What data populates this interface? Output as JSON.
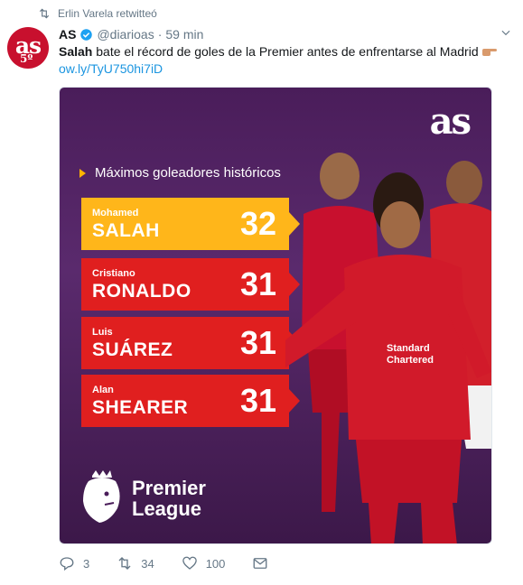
{
  "retweet": {
    "label": "Erlin Varela retwitteó"
  },
  "author": {
    "name": "AS",
    "handle": "@diarioas",
    "time": "59 min"
  },
  "tweet": {
    "bold_word": "Salah",
    "text": " bate el récord de goles de la Premier antes de enfrentarse al Madrid",
    "link": "ow.ly/TyU750hi7iD"
  },
  "media": {
    "brand": "as",
    "heading": "Máximos goleadores históricos",
    "ranking": [
      {
        "first_name": "Mohamed",
        "last_name": "SALAH",
        "goals": "32"
      },
      {
        "first_name": "Cristiano",
        "last_name": "RONALDO",
        "goals": "31"
      },
      {
        "first_name": "Luis",
        "last_name": "SUÁREZ",
        "goals": "31"
      },
      {
        "first_name": "Alan",
        "last_name": "SHEARER",
        "goals": "31"
      }
    ],
    "league_line1": "Premier",
    "league_line2": "League",
    "sponsor": "Standard Chartered"
  },
  "actions": {
    "replies": "3",
    "retweets": "34",
    "likes": "100"
  },
  "colors": {
    "link": "#1b95e0",
    "gold": "#ffb61a",
    "red": "#e01f1f",
    "purple": "#4a1d5a"
  }
}
